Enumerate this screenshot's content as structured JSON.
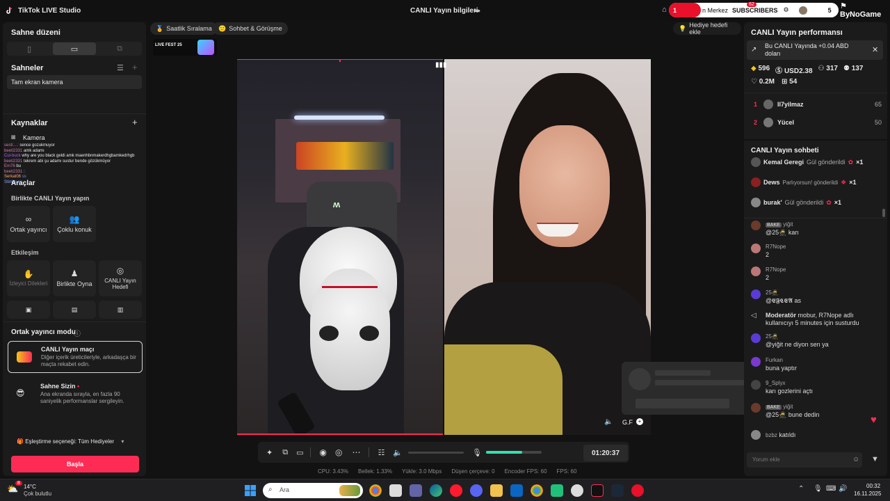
{
  "app": {
    "title": "TikTok LIVE Studio",
    "window_title": "CANLI Yayın bilgileri"
  },
  "topbar": {
    "notif_count": "1",
    "center_text": "n Merkez",
    "subscribers_label": "SUBSCRIBERS",
    "subscribers_count": "5",
    "badge_count": "62",
    "brand": "ByNoGame"
  },
  "left": {
    "scene_layout_title": "Sahne düzeni",
    "scenes_title": "Sahneler",
    "scene_item": "Tam ekran kamera",
    "sources_title": "Kaynaklar",
    "source_camera": "Kamera",
    "chat_overlay": [
      {
        "user": "sesti:...:",
        "text": "sence gozukmuyor"
      },
      {
        "user": "beeti2331",
        "text": "amk adamı"
      },
      {
        "user": "Cui-buck",
        "text": "why are you black geldi amk maenhbnmakerdhgbamkedrhgb"
      },
      {
        "user": "beeti2331",
        "text": "tekrem abi şu adamı sustur bende gözükmüyor"
      },
      {
        "user": "Em76",
        "text": "bu"
      },
      {
        "user": "beeti2331",
        "text": ":"
      },
      {
        "user": "Serkat06",
        "text": "ss"
      },
      {
        "user": "Stinkp:",
        "text": "ss"
      }
    ],
    "tools_title": "Araçlar",
    "collab_title": "Birlikte CANLI Yayın yapın",
    "tile_cohost": "Ortak yayıncı",
    "tile_multiguest": "Çoklu konuk",
    "interaction_title": "Etkileşim",
    "tile_viewer_requests": "İzleyici Dilekleri",
    "tile_play_together": "Birlikte Oyna",
    "tile_live_goal": "CANLI Yayın Hedefi",
    "cohost_mode_title": "Ortak yayıncı modu",
    "match_title": "CANLI Yayın maçı",
    "match_desc": "Diğer içerik üreticileriyle, arkadaşça bir maçta rekabet edin.",
    "stage_title": "Sahne Sizin",
    "stage_desc": "Ana ekranda sırayla, en fazla 90 saniyelik performanslar sergileyin.",
    "matching_option": "Eşleştirme seçeneği: Tüm Hediyeler",
    "start_button": "Başla"
  },
  "center": {
    "chip_hourly": "Saatlik Sıralama",
    "chip_chat": "Sohbet & Görüşme",
    "gift_goal": "Hediye hedefi ekle",
    "event_logo": "LIVE FEST 25",
    "guest_name": "G.F",
    "timer": "01:20:37",
    "stats": {
      "cpu": "CPU: 3.43%",
      "memory": "Bellek: 1.33%",
      "upload": "Yükle: 3.0 Mbps",
      "dropped": "Düşen çerçeve: 0",
      "encoder_fps": "Encoder FPS: 60",
      "fps": "FPS: 60"
    },
    "mic_level": 0.65
  },
  "right": {
    "perf_title": "CANLI Yayın performansı",
    "perf_banner": "Bu CANLI Yayında +0.04 ABD doları",
    "stats": [
      {
        "icon": "diamond-icon",
        "value": "596"
      },
      {
        "icon": "dollar-icon",
        "value": "USD2.38"
      },
      {
        "icon": "viewers-icon",
        "value": "317"
      },
      {
        "icon": "followers-icon",
        "value": "137"
      },
      {
        "icon": "likes-icon",
        "value": "0.2M"
      },
      {
        "icon": "gift-icon",
        "value": "54"
      }
    ],
    "ranking": [
      {
        "rank": "1",
        "name": "Il7yilmaz",
        "score": "65"
      },
      {
        "rank": "2",
        "name": "Yücel",
        "score": "50"
      }
    ],
    "chat_title": "CANLI Yayın sohbeti",
    "gifts": [
      {
        "user": "Kemal Geregi",
        "text": "Gül gönderildi",
        "count": "×1"
      },
      {
        "user": "Dews",
        "text": "Parlıyorsun! gönderildi",
        "count": "×1"
      },
      {
        "user": "burak'",
        "text": "Gül gönderildi",
        "count": "×1"
      }
    ],
    "messages": [
      {
        "user": "yiğit",
        "badge": "BAKE",
        "text": "@25🥷 karı",
        "color": "#6a3a2a"
      },
      {
        "user": "R7Nope",
        "badge": "",
        "text": "2",
        "color": "#b77"
      },
      {
        "user": "R7Nope",
        "badge": "",
        "text": "2",
        "color": "#b77"
      },
      {
        "user": "25🥷",
        "badge": "",
        "text": "@𝕰𝕱𝕮𝕰𝕬 as",
        "color": "#5b3bd6"
      },
      {
        "user": "Moderatör",
        "badge": "",
        "text": "mobur, R7Nope adlı kullanıcıyı 5 minutes için susturdu",
        "color": "#555"
      },
      {
        "user": "25🥷",
        "badge": "",
        "text": "@yiğit ne diyon sen ya",
        "color": "#5b3bd6"
      },
      {
        "user": "Furkan",
        "badge": "",
        "text": "buna yaptır",
        "color": "#7a3ad0"
      },
      {
        "user": "9_Splyx",
        "badge": "",
        "text": "karı gozlerini açtı",
        "color": "#444"
      },
      {
        "user": "yiğit",
        "badge": "BAKE",
        "text": "@25🥷 bune dedin",
        "color": "#6a3a2a"
      },
      {
        "user": "bzbz",
        "badge": "",
        "text": "katıldı",
        "color": "#888"
      }
    ],
    "comment_placeholder": "Yorum ekle"
  },
  "taskbar": {
    "weather_temp": "14°C",
    "weather_desc": "Çok bulutlu",
    "weather_badge": "8",
    "search_placeholder": "Ara",
    "time": "00:32",
    "date": "16.11.2025"
  },
  "colors": {
    "accent": "#fe2c55",
    "panel": "#1b1b1b",
    "background": "#121212"
  }
}
